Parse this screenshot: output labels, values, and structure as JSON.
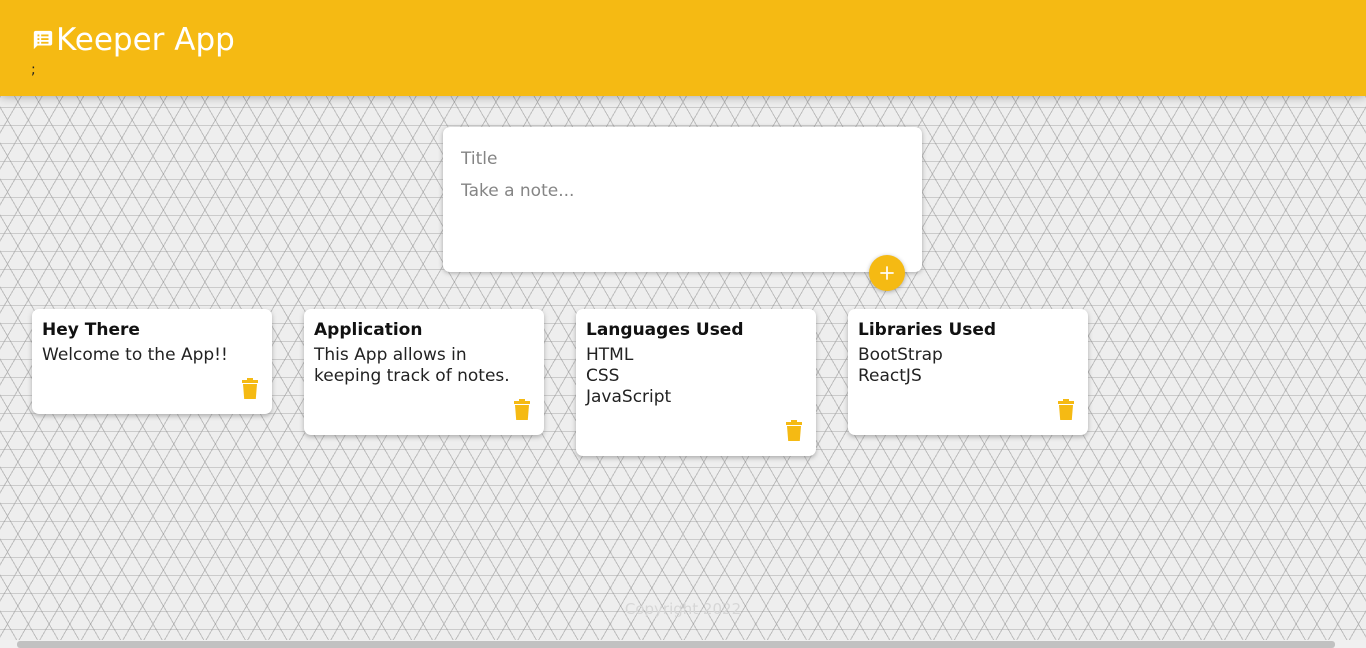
{
  "header": {
    "title": "Keeper App",
    "trailing_text": ";",
    "background_color": "#f5ba13",
    "icon": "note-icon"
  },
  "create_area": {
    "title_placeholder": "Title",
    "content_placeholder": "Take a note...",
    "add_icon": "plus-icon"
  },
  "notes": [
    {
      "title": "Hey There",
      "content": "Welcome to the App!!",
      "delete_icon": "trash-icon"
    },
    {
      "title": "Application",
      "content": "This App allows in\nkeeping track of notes.",
      "delete_icon": "trash-icon"
    },
    {
      "title": "Languages Used",
      "content": "HTML\nCSS\nJavaScript",
      "delete_icon": "trash-icon"
    },
    {
      "title": "Libraries Used",
      "content": "BootStrap\nReactJS",
      "delete_icon": "trash-icon"
    }
  ],
  "footer": {
    "text": "Copyright 2022"
  },
  "colors": {
    "accent": "#f5ba13",
    "note_background": "#ffffff"
  }
}
